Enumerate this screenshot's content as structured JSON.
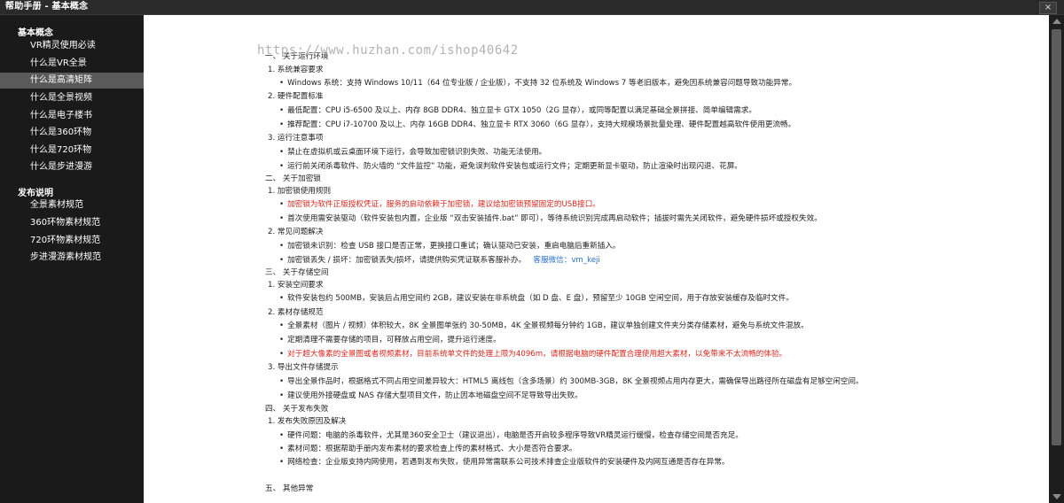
{
  "window": {
    "title": "帮助手册 - 基本概念",
    "close_label": "×"
  },
  "sidebar": {
    "sections": [
      {
        "title": "基本概念",
        "items": [
          "VR精灵使用必读",
          "什么是VR全景",
          "什么是高清矩阵",
          "什么是全景视频",
          "什么是电子楼书",
          "什么是360环物",
          "什么是720环物",
          "什么是步进漫游"
        ]
      },
      {
        "title": "发布说明",
        "items": [
          "全景素材规范",
          "360环物素材规范",
          "720环物素材规范",
          "步进漫游素材规范"
        ]
      }
    ],
    "active_item": "什么是高清矩阵"
  },
  "watermark": "https://www.huzhan.com/ishop40642",
  "doc": {
    "s1": "一、 关于运行环境",
    "s1_1": "1. 系统兼容要求",
    "s1_1_b1": "Windows 系统：支持 Windows 10/11（64 位专业版 / 企业版），不支持 32 位系统及 Windows 7 等老旧版本，避免因系统兼容问题导致功能异常。",
    "s1_2": "2. 硬件配置标准",
    "s1_2_b1": "最低配置：CPU i5-6500 及以上、内存 8GB DDR4、独立显卡 GTX 1050（2G 显存），或同等配置以满足基础全景拼接、简单编辑需求。",
    "s1_2_b2": "推荐配置：CPU i7-10700 及以上、内存 16GB DDR4、独立显卡 RTX 3060（6G 显存），支持大规模场景批量处理、硬件配置越高软件使用更流畅。",
    "s1_3": "3. 运行注意事项",
    "s1_3_b1": "禁止在虚拟机或云桌面环境下运行，会导致加密锁识别失败、功能无法使用。",
    "s1_3_b2": "运行前关闭杀毒软件、防火墙的 “文件监控” 功能，避免误判软件安装包或运行文件；定期更新显卡驱动，防止渲染时出现闪退、花屏。",
    "s2": "二、 关于加密锁",
    "s2_1": "1. 加密锁使用规则",
    "s2_1_b1": "加密锁为软件正版授权凭证，服务的启动依赖于加密锁，建议给加密锁预留固定的USB接口。",
    "s2_1_b2": "首次使用需安装驱动（软件安装包内置，企业版 “双击安装插件.bat” 即可），等待系统识别完成再启动软件；插拔时需先关闭软件，避免硬件损坏或授权失效。",
    "s2_2": "2. 常见问题解决",
    "s2_2_b1": "加密锁未识别：检查 USB 接口是否正常，更换接口重试；确认驱动已安装，重启电脑后重新插入。",
    "s2_2_b2": "加密锁丢失 / 损坏：加密锁丢失/损坏，请提供购买凭证联系客服补办。",
    "s2_2_b2_link": "客服微信：vm_keji",
    "s3": "三、 关于存储空间",
    "s3_1": "1. 安装空间要求",
    "s3_1_b1": "软件安装包约 500MB，安装后占用空间约 2GB，建议安装在非系统盘（如 D 盘、E 盘），预留至少 10GB 空闲空间，用于存放安装缓存及临时文件。",
    "s3_2": "2. 素材存储规范",
    "s3_2_b1": "全景素材（图片 / 视频）体积较大，8K 全景图单张约 30-50MB，4K 全景视频每分钟约 1GB，建议单独创建文件夹分类存储素材，避免与系统文件混放。",
    "s3_2_b2": "定期清理不需要存储的项目，可释放占用空间，提升运行速度。",
    "s3_2_b3": "对于超大像素的全景图或者视频素材，目前系统单文件的处理上限为4096m，请根据电脑的硬件配置合理使用超大素材，以免带来不太流畅的体验。",
    "s3_3": "3. 导出文件存储提示",
    "s3_3_b1": "导出全景作品时，根据格式不同占用空间差异较大：HTML5 离线包（含多场景）约 300MB-3GB，8K 全景视频占用内存更大，需确保导出路径所在磁盘有足够空闲空间。",
    "s3_3_b2": "建议使用外接硬盘或 NAS 存储大型项目文件，防止因本地磁盘空间不足导致导出失败。",
    "s4": "四、 关于发布失败",
    "s4_1": "1. 发布失败原因及解决",
    "s4_1_b1": "硬件问题：电脑的杀毒软件，尤其是360安全卫士（建议退出），电脑是否开启较多程序导致VR精灵运行缓慢，检查存储空间是否充足。",
    "s4_1_b2": "素材问题：根据帮助手册内发布素材的要求检查上传的素材格式、大小是否符合要求。",
    "s4_1_b3": "网络检查：企业版支持内网使用，若遇到发布失败，使用异常需联系公司技术排查企业版软件的安装硬件及内网互通是否存在异常。",
    "s5": "五、 其他异常"
  }
}
